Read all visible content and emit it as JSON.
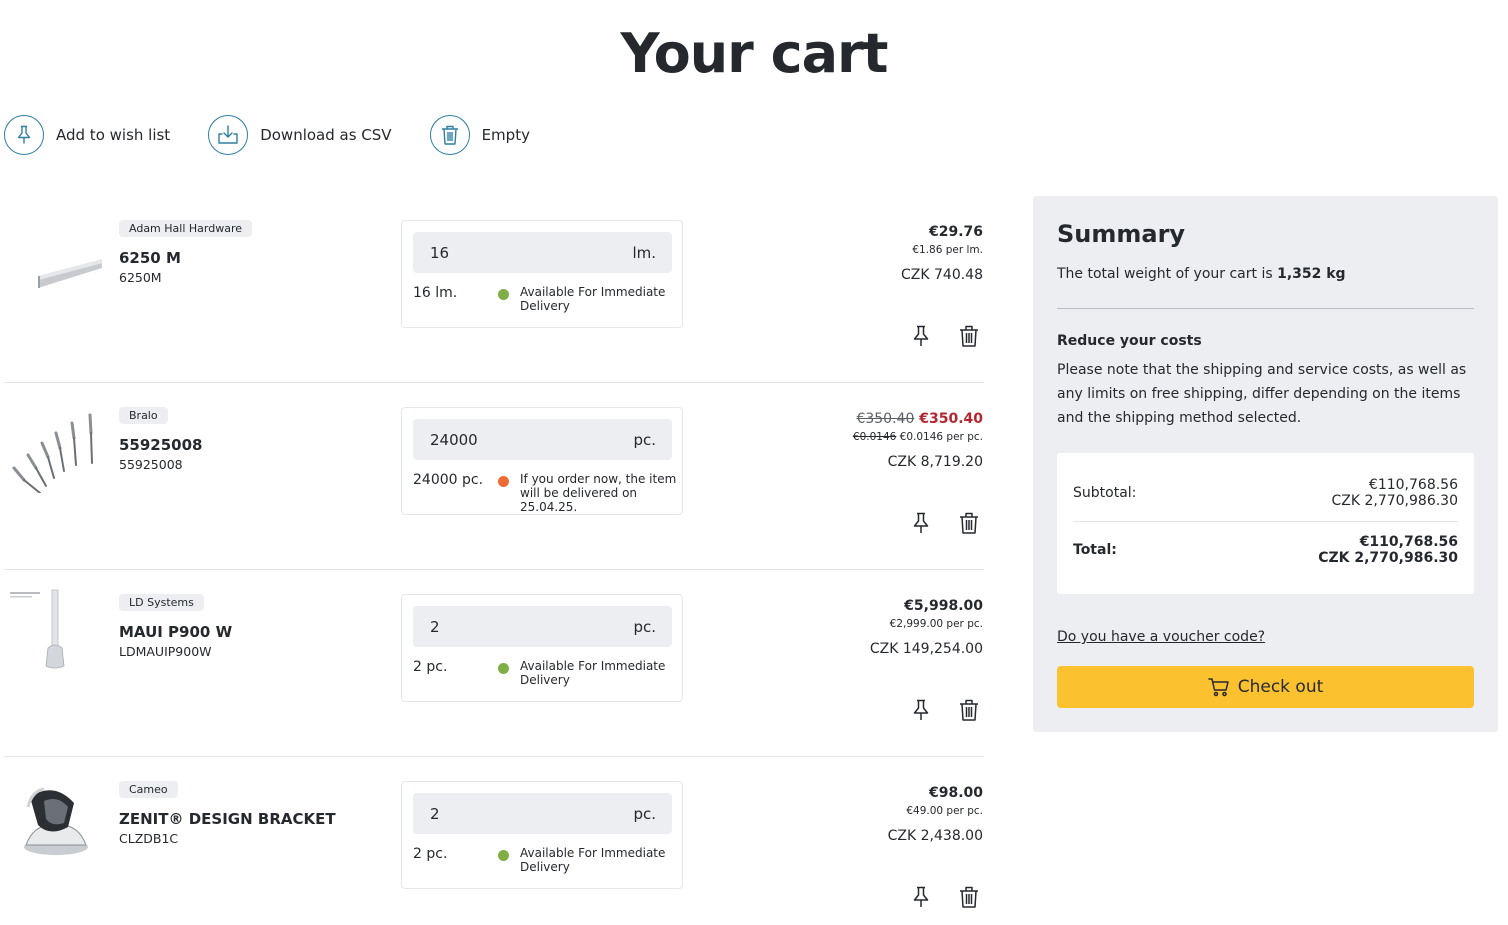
{
  "page": {
    "title": "Your cart"
  },
  "actions": [
    {
      "label": "Add to wish list",
      "icon": "pin-icon"
    },
    {
      "label": "Download as CSV",
      "icon": "download-icon"
    },
    {
      "label": "Empty",
      "icon": "trash-icon"
    }
  ],
  "items": [
    {
      "brand": "Adam Hall Hardware",
      "name": "6250 M",
      "sku": "6250M",
      "qty": "16",
      "unit": "lm.",
      "qty_total": "16 lm.",
      "availability": "Available For Immediate Delivery",
      "status_color": "#7fae45",
      "price_old": "",
      "price": "€29.76",
      "per_unit_old": "",
      "per_unit": "€1.86 per lm.",
      "czk": "CZK 740.48"
    },
    {
      "brand": "Bralo",
      "name": "55925008",
      "sku": "55925008",
      "qty": "24000",
      "unit": "pc.",
      "qty_total": "24000 pc.",
      "availability": "If you order now, the item will be delivered on 25.04.25.",
      "status_color": "#ee6b35",
      "price_old": "€350.40",
      "price": "€350.40",
      "per_unit_old": "€0.0146",
      "per_unit": "€0.0146 per pc.",
      "czk": "CZK 8,719.20"
    },
    {
      "brand": "LD Systems",
      "name": "MAUI P900 W",
      "sku": "LDMAUIP900W",
      "qty": "2",
      "unit": "pc.",
      "qty_total": "2 pc.",
      "availability": "Available For Immediate Delivery",
      "status_color": "#7fae45",
      "price_old": "",
      "price": "€5,998.00",
      "per_unit_old": "",
      "per_unit": "€2,999.00 per pc.",
      "czk": "CZK 149,254.00"
    },
    {
      "brand": "Cameo",
      "name": "ZENIT® DESIGN BRACKET",
      "sku": "CLZDB1C",
      "qty": "2",
      "unit": "pc.",
      "qty_total": "2 pc.",
      "availability": "Available For Immediate Delivery",
      "status_color": "#7fae45",
      "price_old": "",
      "price": "€98.00",
      "per_unit_old": "",
      "per_unit": "€49.00 per pc.",
      "czk": "CZK 2,438.00"
    }
  ],
  "summary": {
    "title": "Summary",
    "weight_prefix": "The total weight of your cart is ",
    "weight_value": "1,352 kg",
    "reduce_title": "Reduce your costs",
    "reduce_text": "Please note that the shipping and service costs, as well as any limits on free shipping, differ depending on the items and the shipping method selected.",
    "subtotal_label": "Subtotal:",
    "subtotal_eur": "€110,768.56",
    "subtotal_czk": "CZK 2,770,986.30",
    "total_label": "Total:",
    "total_eur": "€110,768.56",
    "total_czk": "CZK 2,770,986.30",
    "voucher_link": "Do you have a voucher code?",
    "checkout_label": "Check out"
  },
  "colors": {
    "accent": "#2f7fa3",
    "checkout": "#fbc12e",
    "sale": "#b3262f",
    "panel": "#eceef1"
  }
}
